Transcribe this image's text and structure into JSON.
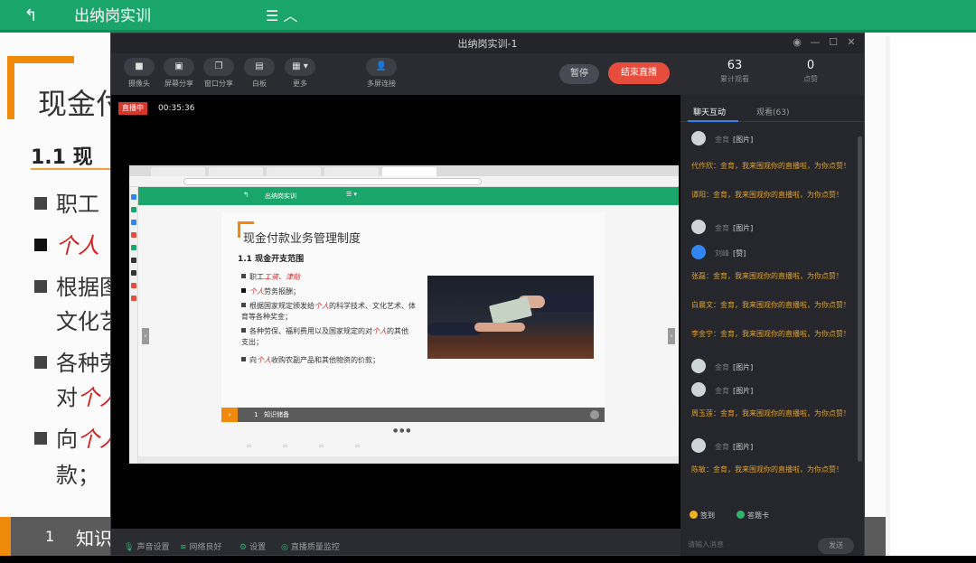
{
  "course_page": {
    "back_icon": "back-arrow-icon",
    "title": "出纳岗实训",
    "menu": "☰ ︿",
    "slide_title": "现金付",
    "section_heading": "1.1  现",
    "bullets": [
      {
        "text": "职工",
        "red": ""
      },
      {
        "text": "",
        "red": "个人"
      },
      {
        "text": "根据图",
        "red": ""
      },
      {
        "text": "文化艺",
        "red": ""
      },
      {
        "text": "各种劳",
        "red": ""
      },
      {
        "text": "对",
        "red": "个人"
      },
      {
        "text": "向",
        "red": "个人"
      },
      {
        "text": "款；",
        "red": ""
      }
    ],
    "footer_num": "1",
    "footer_text": "知识"
  },
  "live_window": {
    "title": "出纳岗实训-1",
    "toolbar": [
      {
        "label": "摄像头",
        "icon": "camera-icon",
        "glyph": "■"
      },
      {
        "label": "屏幕分享",
        "icon": "screen-share-icon",
        "glyph": "▣"
      },
      {
        "label": "窗口分享",
        "icon": "window-share-icon",
        "glyph": "❐"
      },
      {
        "label": "白板",
        "icon": "whiteboard-icon",
        "glyph": "▤"
      },
      {
        "label": "更多",
        "icon": "more-grid-icon",
        "glyph": "▦ ▾"
      },
      {
        "label": "多屏连接",
        "icon": "user-icon",
        "glyph": "👤"
      }
    ],
    "pause_label": "暂停",
    "end_live_label": "结束直播",
    "live_badge": "直播中",
    "live_time": "00:35:36",
    "footer": [
      {
        "label": "声音设置",
        "icon": "microphone-icon",
        "glyph": "🎙"
      },
      {
        "label": "网络良好",
        "icon": "wifi-icon",
        "glyph": "≋"
      },
      {
        "label": "设置",
        "icon": "gear-icon",
        "glyph": "⚙"
      },
      {
        "label": "直播质量监控",
        "icon": "monitor-icon",
        "glyph": "◎"
      }
    ]
  },
  "shared_screen": {
    "page_title": "出纳岗实训",
    "slide_title": "现金付款业务管理制度",
    "section_heading": "1.1  现金开支范围",
    "bullets": [
      {
        "text": "职工",
        "red": "工资、津贴",
        "after": ""
      },
      {
        "text": "",
        "red": "个人",
        "after": "劳务报酬；"
      },
      {
        "text": "根据国家规定颁发给",
        "red": "个人",
        "after": "的科学技术、文化艺术、体育等各种奖金；"
      },
      {
        "text": "各种劳保、福利费用以及国家规定的对",
        "red": "个人",
        "after": "的其他支出；"
      },
      {
        "text": "向",
        "red": "个人",
        "after": "收购农副产品和其他物资的价款；"
      }
    ],
    "footer_num": "1",
    "footer_text": "知识储备",
    "pager": "● ● ●"
  },
  "stats": {
    "viewers": {
      "num": "63",
      "label": "累计观看"
    },
    "likes": {
      "num": "0",
      "label": "点赞"
    }
  },
  "chat": {
    "tabs": [
      "聊天互动",
      "观看(63)"
    ],
    "messages": [
      {
        "type": "img",
        "name": "金育",
        "value": "[图片]"
      },
      {
        "type": "txt",
        "text": "代作欣：金育，我来围观你的直播啦，为你点赞！"
      },
      {
        "type": "txt",
        "text": "谭阳：金育，我来围观你的直播啦，为你点赞！"
      },
      {
        "type": "img",
        "name": "金育",
        "value": "[图片]"
      },
      {
        "type": "img",
        "name": "刘峰",
        "value": "[赞]",
        "blue": true
      },
      {
        "type": "txt",
        "text": "张磊：金育，我来围观你的直播啦，为你点赞！"
      },
      {
        "type": "txt",
        "text": "白晨文：金育，我来围观你的直播啦，为你点赞！"
      },
      {
        "type": "txt",
        "text": "李金宁：金育，我来围观你的直播啦，为你点赞！"
      },
      {
        "type": "img",
        "name": "金育",
        "value": "[图片]"
      },
      {
        "type": "img",
        "name": "金育",
        "value": "[图片]"
      },
      {
        "type": "txt",
        "text": "周玉莲：金育，我来围观你的直播啦，为你点赞！"
      },
      {
        "type": "img",
        "name": "金育",
        "value": "[图片]"
      },
      {
        "type": "txt",
        "text": "陈敏：金育，我来围观你的直播啦，为你点赞！"
      }
    ],
    "options": [
      {
        "label": "签到",
        "color": "#f2b01e"
      },
      {
        "label": "答题卡",
        "color": "#2fb36d"
      }
    ],
    "input_placeholder": "请输入消息",
    "send_label": "发送"
  }
}
